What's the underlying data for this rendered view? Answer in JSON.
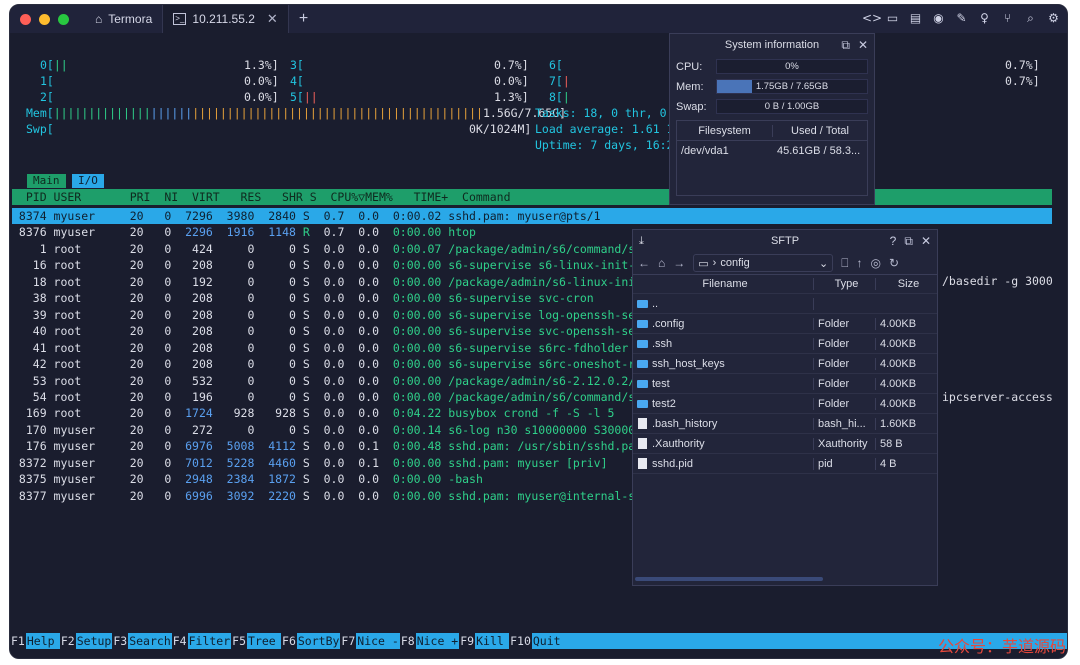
{
  "tabs": [
    {
      "label": "Termora"
    },
    {
      "label": "10.211.55.2"
    }
  ],
  "cpu": {
    "rows": [
      [
        "0[||",
        "1.3%]",
        "3[",
        "0.7%]",
        "6[",
        "0.7%]"
      ],
      [
        "1[",
        "0.0%]",
        "4[",
        "0.0%]",
        "7[|",
        "0.7%]"
      ],
      [
        "2[",
        "0.0%]",
        "5[||",
        "1.3%]",
        "8[|",
        ""
      ]
    ]
  },
  "mem": {
    "label": "Mem[",
    "value": "1.56G/7.65G]",
    "tail": "Tasks: 18, 0 thr, 0 "
  },
  "swp": {
    "label": "Swp[",
    "value": "0K/1024M]",
    "load": "Load average: 1.61 1"
  },
  "uptime": "Uptime: 7 days, 16:2",
  "mode_tabs": [
    "Main",
    "I/O"
  ],
  "header": "  PID USER       PRI  NI  VIRT   RES   SHR S  CPU%▽MEM%   TIME+  Command",
  "processes": [
    [
      "8374",
      "myuser",
      "20",
      "0",
      "7296",
      "3980",
      "2840",
      "S",
      "0.7",
      "0.0",
      "0:00.02",
      "sshd.pam: myuser@pts/1"
    ],
    [
      "8376",
      "myuser",
      "20",
      "0",
      "2296",
      "1916",
      "1148",
      "R",
      "0.7",
      "0.0",
      "0:00.00",
      "htop"
    ],
    [
      "1",
      "root",
      "20",
      "0",
      "424",
      "0",
      "0",
      "S",
      "0.0",
      "0.0",
      "0:00.07",
      "/package/admin/s6/command/s6-"
    ],
    [
      "16",
      "root",
      "20",
      "0",
      "208",
      "0",
      "0",
      "S",
      "0.0",
      "0.0",
      "0:00.00",
      "s6-supervise s6-linux-init-sh"
    ],
    [
      "18",
      "root",
      "20",
      "0",
      "192",
      "0",
      "0",
      "S",
      "0.0",
      "0.0",
      "0:00.00",
      "/package/admin/s6-linux-init/"
    ],
    [
      "38",
      "root",
      "20",
      "0",
      "208",
      "0",
      "0",
      "S",
      "0.0",
      "0.0",
      "0:00.00",
      "s6-supervise svc-cron"
    ],
    [
      "39",
      "root",
      "20",
      "0",
      "208",
      "0",
      "0",
      "S",
      "0.0",
      "0.0",
      "0:00.00",
      "s6-supervise log-openssh-serv"
    ],
    [
      "40",
      "root",
      "20",
      "0",
      "208",
      "0",
      "0",
      "S",
      "0.0",
      "0.0",
      "0:00.00",
      "s6-supervise svc-openssh-serv"
    ],
    [
      "41",
      "root",
      "20",
      "0",
      "208",
      "0",
      "0",
      "S",
      "0.0",
      "0.0",
      "0:00.00",
      "s6-supervise s6rc-fdholder"
    ],
    [
      "42",
      "root",
      "20",
      "0",
      "208",
      "0",
      "0",
      "S",
      "0.0",
      "0.0",
      "0:00.00",
      "s6-supervise s6rc-oneshot-run"
    ],
    [
      "53",
      "root",
      "20",
      "0",
      "532",
      "0",
      "0",
      "S",
      "0.0",
      "0.0",
      "0:00.00",
      "/package/admin/s6-2.12.0.2/co"
    ],
    [
      "54",
      "root",
      "20",
      "0",
      "196",
      "0",
      "0",
      "S",
      "0.0",
      "0.0",
      "0:00.00",
      "/package/admin/s6/command/s6-"
    ],
    [
      "169",
      "root",
      "20",
      "0",
      "1724",
      "928",
      "928",
      "S",
      "0.0",
      "0.0",
      "0:04.22",
      "busybox crond -f -S -l 5"
    ],
    [
      "170",
      "myuser",
      "20",
      "0",
      "272",
      "0",
      "0",
      "S",
      "0.0",
      "0.0",
      "0:00.14",
      "s6-log n30 s10000000 S300000"
    ],
    [
      "176",
      "myuser",
      "20",
      "0",
      "6976",
      "5008",
      "4112",
      "S",
      "0.0",
      "0.1",
      "0:00.48",
      "sshd.pam: /usr/sbin/sshd.pam"
    ],
    [
      "8372",
      "myuser",
      "20",
      "0",
      "7012",
      "5228",
      "4460",
      "S",
      "0.0",
      "0.1",
      "0:00.00",
      "sshd.pam: myuser [priv]"
    ],
    [
      "8375",
      "myuser",
      "20",
      "0",
      "2948",
      "2384",
      "1872",
      "S",
      "0.0",
      "0.0",
      "0:00.00",
      "-bash"
    ],
    [
      "8377",
      "myuser",
      "20",
      "0",
      "6996",
      "3092",
      "2220",
      "S",
      "0.0",
      "0.0",
      "0:00.00",
      "sshd.pam: myuser@internal-sft"
    ]
  ],
  "overflow_right": {
    "row18": "/basedir -g 3000",
    "row54": "ipcserver-access"
  },
  "fkeys": [
    [
      "F1",
      "Help"
    ],
    [
      "F2",
      "Setup"
    ],
    [
      "F3",
      "Search"
    ],
    [
      "F4",
      "Filter"
    ],
    [
      "F5",
      "Tree"
    ],
    [
      "F6",
      "SortBy"
    ],
    [
      "F7",
      "Nice -"
    ],
    [
      "F8",
      "Nice +"
    ],
    [
      "F9",
      "Kill"
    ],
    [
      "F10",
      "Quit"
    ]
  ],
  "sysinfo": {
    "title": "System information",
    "cpu_label": "CPU:",
    "cpu_value": "0%",
    "cpu_fraction": 0.0,
    "mem_label": "Mem:",
    "mem_value": "1.75GB / 7.65GB",
    "mem_fraction": 0.23,
    "swap_label": "Swap:",
    "swap_value": "0 B / 1.00GB",
    "swap_fraction": 0.0,
    "fs_headers": [
      "Filesystem",
      "Used / Total"
    ],
    "fs_rows": [
      [
        "/dev/vda1",
        "45.61GB / 58.3..."
      ]
    ]
  },
  "sftp": {
    "title": "SFTP",
    "path": "config",
    "headers": [
      "Filename",
      "Type",
      "Size"
    ],
    "files": [
      {
        "name": "..",
        "type": "",
        "size": "",
        "kind": "folder"
      },
      {
        "name": ".config",
        "type": "Folder",
        "size": "4.00KB",
        "kind": "folder"
      },
      {
        "name": ".ssh",
        "type": "Folder",
        "size": "4.00KB",
        "kind": "folder"
      },
      {
        "name": "ssh_host_keys",
        "type": "Folder",
        "size": "4.00KB",
        "kind": "folder"
      },
      {
        "name": "test",
        "type": "Folder",
        "size": "4.00KB",
        "kind": "folder"
      },
      {
        "name": "test2",
        "type": "Folder",
        "size": "4.00KB",
        "kind": "folder"
      },
      {
        "name": ".bash_history",
        "type": "bash_hi...",
        "size": "1.60KB",
        "kind": "file"
      },
      {
        "name": ".Xauthority",
        "type": "Xauthority",
        "size": "58 B",
        "kind": "file"
      },
      {
        "name": "sshd.pid",
        "type": "pid",
        "size": "4 B",
        "kind": "file"
      }
    ]
  },
  "watermark": "公众号：芋道源码",
  "colors": {
    "accent": "#2aa8e8",
    "header_green": "#1e9e6a",
    "cyan": "#22c5e0",
    "green": "#2fd08a",
    "orange": "#e8a23a"
  }
}
